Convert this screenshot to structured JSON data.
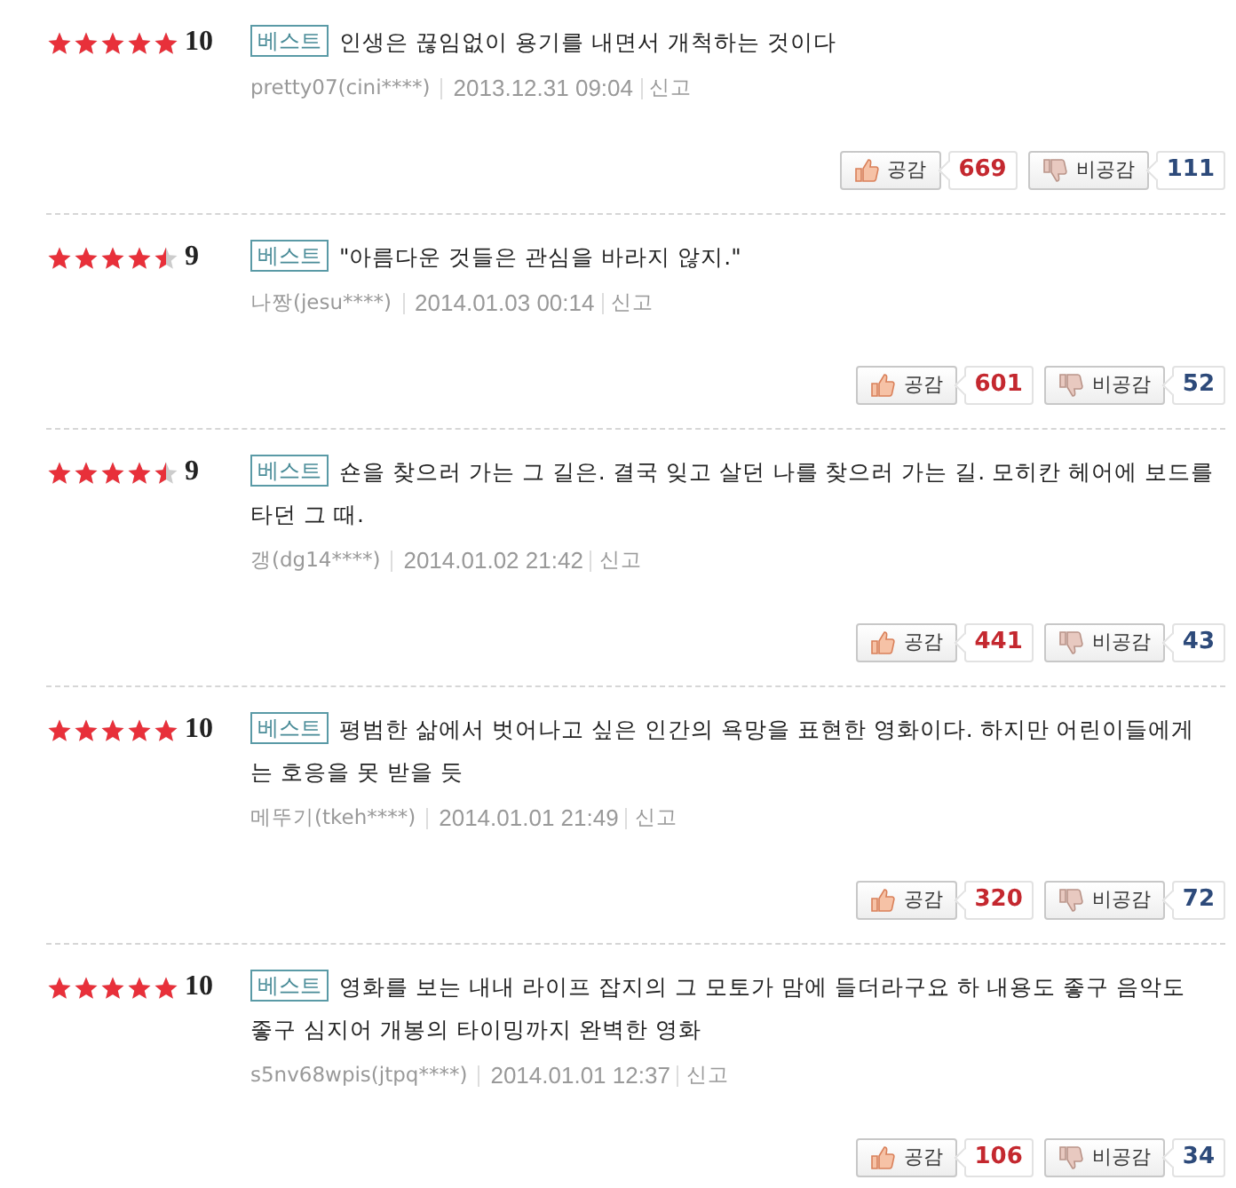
{
  "reviews": [
    {
      "stars": 5,
      "score": "10",
      "badge": "베스트",
      "text": "인생은 끊임없이 용기를 내면서 개척하는 것이다",
      "author": "pretty07(cini****)",
      "date": "2013.12.31 09:04",
      "report": "신고",
      "like_label": "공감",
      "like_count": "669",
      "dislike_label": "비공감",
      "dislike_count": "111"
    },
    {
      "stars": 4.5,
      "score": "9",
      "badge": "베스트",
      "text": "\"아름다운 것들은 관심을 바라지 않지.\"",
      "author": "나짱(jesu****)",
      "date": "2014.01.03 00:14",
      "report": "신고",
      "like_label": "공감",
      "like_count": "601",
      "dislike_label": "비공감",
      "dislike_count": "52"
    },
    {
      "stars": 4.5,
      "score": "9",
      "badge": "베스트",
      "text": "숀을 찾으러 가는 그 길은. 결국 잊고 살던 나를 찾으러 가는 길. 모히칸 헤어에 보드를 타던 그 때.",
      "author": "갱(dg14****)",
      "date": "2014.01.02 21:42",
      "report": "신고",
      "like_label": "공감",
      "like_count": "441",
      "dislike_label": "비공감",
      "dislike_count": "43"
    },
    {
      "stars": 5,
      "score": "10",
      "badge": "베스트",
      "text": "평범한 삶에서 벗어나고 싶은 인간의 욕망을 표현한 영화이다. 하지만 어린이들에게는 호응을 못 받을 듯",
      "author": "메뚜기(tkeh****)",
      "date": "2014.01.01 21:49",
      "report": "신고",
      "like_label": "공감",
      "like_count": "320",
      "dislike_label": "비공감",
      "dislike_count": "72"
    },
    {
      "stars": 5,
      "score": "10",
      "badge": "베스트",
      "text": "영화를 보는 내내 라이프 잡지의 그 모토가 맘에 들더라구요 하 내용도 좋구 음악도 좋구 심지어 개봉의 타이밍까지 완벽한 영화",
      "author": "s5nv68wpis(jtpq****)",
      "date": "2014.01.01 12:37",
      "report": "신고",
      "like_label": "공감",
      "like_count": "106",
      "dislike_label": "비공감",
      "dislike_count": "34"
    }
  ]
}
